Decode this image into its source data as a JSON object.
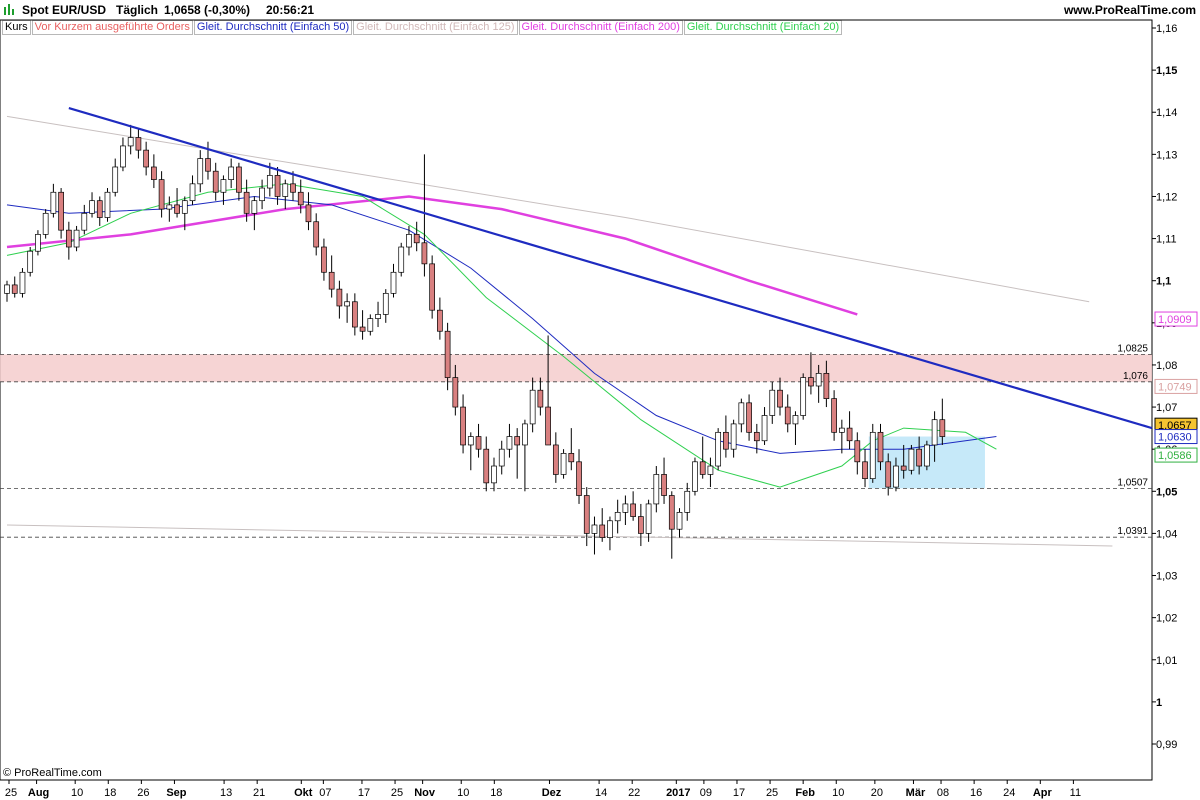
{
  "header": {
    "symbol": "Spot EUR/USD",
    "interval": "Täglich",
    "quote": "1,0658 (-0,30%)",
    "time": "20:56:21",
    "site": "www.ProRealTime.com"
  },
  "legend": [
    {
      "label": "Kurs",
      "color": "#000000"
    },
    {
      "label": "Vor Kurzem ausgeführte Orders",
      "color": "#e86060"
    },
    {
      "label": "Gleit. Durchschnitt (Einfach 50)",
      "color": "#1e2bc0"
    },
    {
      "label": "Gleit. Durchschnitt (Einfach 125)",
      "color": "#d0b8b8"
    },
    {
      "label": "Gleit. Durchschnitt (Einfach 200)",
      "color": "#e040e0"
    },
    {
      "label": "Gleit. Durchschnitt (Einfach 20)",
      "color": "#30d050"
    }
  ],
  "copyright": "© ProRealTime.com",
  "chart_data": {
    "type": "candlestick",
    "ylim": [
      0.982,
      1.165
    ],
    "y_ticks": [
      "1,16",
      "1,15",
      "1,14",
      "1,13",
      "1,12",
      "1,11",
      "1,1",
      "1,09",
      "1,08",
      "1,07",
      "1,06",
      "1,05",
      "1,04",
      "1,03",
      "1,02",
      "1,01",
      "1",
      "0,99"
    ],
    "y_tick_values": [
      1.16,
      1.15,
      1.14,
      1.13,
      1.12,
      1.11,
      1.1,
      1.09,
      1.08,
      1.07,
      1.06,
      1.05,
      1.04,
      1.03,
      1.02,
      1.01,
      1.0,
      0.99
    ],
    "y_bold_ticks": [
      "1,15",
      "1,1",
      "1,05",
      "1"
    ],
    "x_ticks": [
      {
        "label": "25",
        "d": 0
      },
      {
        "label": "Aug",
        "d": 5,
        "bold": true
      },
      {
        "label": "10",
        "d": 12
      },
      {
        "label": "18",
        "d": 18
      },
      {
        "label": "26",
        "d": 24
      },
      {
        "label": "Sep",
        "d": 30,
        "bold": true
      },
      {
        "label": "13",
        "d": 39
      },
      {
        "label": "21",
        "d": 45
      },
      {
        "label": "Okt",
        "d": 53,
        "bold": true
      },
      {
        "label": "07",
        "d": 57
      },
      {
        "label": "17",
        "d": 64
      },
      {
        "label": "25",
        "d": 70
      },
      {
        "label": "Nov",
        "d": 75,
        "bold": true
      },
      {
        "label": "10",
        "d": 82
      },
      {
        "label": "18",
        "d": 88
      },
      {
        "label": "Dez",
        "d": 98,
        "bold": true
      },
      {
        "label": "14",
        "d": 107
      },
      {
        "label": "22",
        "d": 113
      },
      {
        "label": "2017",
        "d": 121,
        "bold": true
      },
      {
        "label": "09",
        "d": 126
      },
      {
        "label": "17",
        "d": 132
      },
      {
        "label": "25",
        "d": 138
      },
      {
        "label": "Feb",
        "d": 144,
        "bold": true
      },
      {
        "label": "10",
        "d": 150
      },
      {
        "label": "20",
        "d": 157
      },
      {
        "label": "Mär",
        "d": 164,
        "bold": true
      },
      {
        "label": "08",
        "d": 169
      },
      {
        "label": "16",
        "d": 175
      },
      {
        "label": "24",
        "d": 181
      },
      {
        "label": "Apr",
        "d": 187,
        "bold": true
      },
      {
        "label": "11",
        "d": 193
      }
    ],
    "candles": [
      [
        1.097,
        1.1,
        1.095,
        1.099
      ],
      [
        1.099,
        1.101,
        1.096,
        1.097
      ],
      [
        1.097,
        1.103,
        1.096,
        1.102
      ],
      [
        1.102,
        1.108,
        1.101,
        1.107
      ],
      [
        1.107,
        1.112,
        1.106,
        1.111
      ],
      [
        1.111,
        1.117,
        1.11,
        1.116
      ],
      [
        1.116,
        1.123,
        1.115,
        1.121
      ],
      [
        1.121,
        1.122,
        1.11,
        1.112
      ],
      [
        1.112,
        1.114,
        1.105,
        1.108
      ],
      [
        1.108,
        1.113,
        1.107,
        1.112
      ],
      [
        1.112,
        1.118,
        1.111,
        1.116
      ],
      [
        1.116,
        1.121,
        1.115,
        1.119
      ],
      [
        1.119,
        1.12,
        1.113,
        1.115
      ],
      [
        1.115,
        1.122,
        1.114,
        1.121
      ],
      [
        1.121,
        1.129,
        1.12,
        1.127
      ],
      [
        1.127,
        1.134,
        1.126,
        1.132
      ],
      [
        1.132,
        1.137,
        1.13,
        1.134
      ],
      [
        1.134,
        1.136,
        1.129,
        1.131
      ],
      [
        1.131,
        1.133,
        1.125,
        1.127
      ],
      [
        1.127,
        1.13,
        1.122,
        1.124
      ],
      [
        1.124,
        1.126,
        1.115,
        1.117
      ],
      [
        1.117,
        1.12,
        1.114,
        1.118
      ],
      [
        1.118,
        1.122,
        1.115,
        1.116
      ],
      [
        1.116,
        1.12,
        1.112,
        1.119
      ],
      [
        1.119,
        1.125,
        1.118,
        1.123
      ],
      [
        1.123,
        1.131,
        1.121,
        1.129
      ],
      [
        1.129,
        1.133,
        1.124,
        1.126
      ],
      [
        1.126,
        1.128,
        1.119,
        1.121
      ],
      [
        1.121,
        1.125,
        1.118,
        1.124
      ],
      [
        1.124,
        1.129,
        1.122,
        1.127
      ],
      [
        1.127,
        1.128,
        1.119,
        1.121
      ],
      [
        1.121,
        1.124,
        1.114,
        1.116
      ],
      [
        1.116,
        1.12,
        1.112,
        1.119
      ],
      [
        1.119,
        1.124,
        1.117,
        1.122
      ],
      [
        1.122,
        1.128,
        1.12,
        1.125
      ],
      [
        1.125,
        1.127,
        1.118,
        1.12
      ],
      [
        1.12,
        1.124,
        1.117,
        1.123
      ],
      [
        1.123,
        1.126,
        1.119,
        1.121
      ],
      [
        1.121,
        1.124,
        1.116,
        1.118
      ],
      [
        1.118,
        1.121,
        1.112,
        1.114
      ],
      [
        1.114,
        1.116,
        1.106,
        1.108
      ],
      [
        1.108,
        1.11,
        1.1,
        1.102
      ],
      [
        1.102,
        1.106,
        1.096,
        1.098
      ],
      [
        1.098,
        1.1,
        1.091,
        1.094
      ],
      [
        1.094,
        1.097,
        1.09,
        1.095
      ],
      [
        1.095,
        1.097,
        1.087,
        1.089
      ],
      [
        1.089,
        1.093,
        1.086,
        1.088
      ],
      [
        1.088,
        1.092,
        1.087,
        1.091
      ],
      [
        1.091,
        1.095,
        1.089,
        1.092
      ],
      [
        1.092,
        1.098,
        1.09,
        1.097
      ],
      [
        1.097,
        1.104,
        1.096,
        1.102
      ],
      [
        1.102,
        1.109,
        1.101,
        1.108
      ],
      [
        1.108,
        1.113,
        1.106,
        1.111
      ],
      [
        1.111,
        1.114,
        1.107,
        1.109
      ],
      [
        1.109,
        1.13,
        1.101,
        1.104
      ],
      [
        1.104,
        1.106,
        1.091,
        1.093
      ],
      [
        1.093,
        1.096,
        1.086,
        1.088
      ],
      [
        1.088,
        1.09,
        1.074,
        1.077
      ],
      [
        1.077,
        1.08,
        1.068,
        1.07
      ],
      [
        1.07,
        1.073,
        1.059,
        1.061
      ],
      [
        1.061,
        1.064,
        1.055,
        1.063
      ],
      [
        1.063,
        1.066,
        1.058,
        1.06
      ],
      [
        1.06,
        1.063,
        1.05,
        1.052
      ],
      [
        1.052,
        1.058,
        1.05,
        1.056
      ],
      [
        1.056,
        1.062,
        1.054,
        1.06
      ],
      [
        1.06,
        1.066,
        1.058,
        1.063
      ],
      [
        1.063,
        1.065,
        1.053,
        1.061
      ],
      [
        1.061,
        1.067,
        1.05,
        1.066
      ],
      [
        1.066,
        1.077,
        1.064,
        1.074
      ],
      [
        1.074,
        1.077,
        1.068,
        1.07
      ],
      [
        1.07,
        1.087,
        1.066,
        1.061
      ],
      [
        1.061,
        1.064,
        1.052,
        1.054
      ],
      [
        1.054,
        1.06,
        1.053,
        1.059
      ],
      [
        1.059,
        1.065,
        1.055,
        1.057
      ],
      [
        1.057,
        1.06,
        1.047,
        1.049
      ],
      [
        1.049,
        1.051,
        1.037,
        1.04
      ],
      [
        1.04,
        1.044,
        1.035,
        1.042
      ],
      [
        1.042,
        1.046,
        1.038,
        1.039
      ],
      [
        1.039,
        1.044,
        1.036,
        1.043
      ],
      [
        1.043,
        1.048,
        1.04,
        1.045
      ],
      [
        1.045,
        1.049,
        1.042,
        1.047
      ],
      [
        1.047,
        1.05,
        1.043,
        1.044
      ],
      [
        1.044,
        1.047,
        1.037,
        1.04
      ],
      [
        1.04,
        1.048,
        1.038,
        1.047
      ],
      [
        1.047,
        1.056,
        1.045,
        1.054
      ],
      [
        1.054,
        1.058,
        1.047,
        1.049
      ],
      [
        1.049,
        1.05,
        1.034,
        1.041
      ],
      [
        1.041,
        1.046,
        1.039,
        1.045
      ],
      [
        1.045,
        1.052,
        1.043,
        1.05
      ],
      [
        1.05,
        1.058,
        1.049,
        1.057
      ],
      [
        1.057,
        1.063,
        1.053,
        1.054
      ],
      [
        1.054,
        1.058,
        1.051,
        1.056
      ],
      [
        1.056,
        1.065,
        1.055,
        1.064
      ],
      [
        1.064,
        1.068,
        1.058,
        1.06
      ],
      [
        1.06,
        1.067,
        1.058,
        1.066
      ],
      [
        1.066,
        1.072,
        1.064,
        1.071
      ],
      [
        1.071,
        1.073,
        1.062,
        1.064
      ],
      [
        1.064,
        1.066,
        1.059,
        1.062
      ],
      [
        1.062,
        1.07,
        1.061,
        1.068
      ],
      [
        1.068,
        1.076,
        1.066,
        1.074
      ],
      [
        1.074,
        1.077,
        1.068,
        1.07
      ],
      [
        1.07,
        1.073,
        1.064,
        1.066
      ],
      [
        1.066,
        1.069,
        1.061,
        1.068
      ],
      [
        1.068,
        1.078,
        1.067,
        1.077
      ],
      [
        1.077,
        1.083,
        1.073,
        1.075
      ],
      [
        1.075,
        1.08,
        1.071,
        1.078
      ],
      [
        1.078,
        1.081,
        1.07,
        1.072
      ],
      [
        1.072,
        1.074,
        1.062,
        1.064
      ],
      [
        1.064,
        1.067,
        1.059,
        1.065
      ],
      [
        1.065,
        1.069,
        1.06,
        1.062
      ],
      [
        1.062,
        1.064,
        1.054,
        1.057
      ],
      [
        1.057,
        1.06,
        1.051,
        1.053
      ],
      [
        1.053,
        1.066,
        1.052,
        1.064
      ],
      [
        1.064,
        1.066,
        1.055,
        1.057
      ],
      [
        1.057,
        1.059,
        1.049,
        1.051
      ],
      [
        1.051,
        1.058,
        1.05,
        1.056
      ],
      [
        1.056,
        1.061,
        1.053,
        1.055
      ],
      [
        1.055,
        1.061,
        1.054,
        1.06
      ],
      [
        1.06,
        1.063,
        1.054,
        1.056
      ],
      [
        1.056,
        1.062,
        1.055,
        1.061
      ],
      [
        1.061,
        1.069,
        1.057,
        1.067
      ],
      [
        1.067,
        1.072,
        1.061,
        1.063
      ]
    ],
    "sma20": [
      [
        0,
        1.106
      ],
      [
        8,
        1.109
      ],
      [
        16,
        1.116
      ],
      [
        26,
        1.121
      ],
      [
        36,
        1.123
      ],
      [
        46,
        1.12
      ],
      [
        54,
        1.111
      ],
      [
        62,
        1.096
      ],
      [
        72,
        1.082
      ],
      [
        82,
        1.067
      ],
      [
        92,
        1.055
      ],
      [
        100,
        1.051
      ],
      [
        108,
        1.056
      ],
      [
        112,
        1.062
      ],
      [
        116,
        1.065
      ],
      [
        124,
        1.064
      ],
      [
        128,
        1.06
      ]
    ],
    "sma50": [
      [
        0,
        1.118
      ],
      [
        8,
        1.116
      ],
      [
        20,
        1.117
      ],
      [
        32,
        1.12
      ],
      [
        42,
        1.118
      ],
      [
        52,
        1.112
      ],
      [
        60,
        1.103
      ],
      [
        68,
        1.091
      ],
      [
        76,
        1.078
      ],
      [
        84,
        1.068
      ],
      [
        92,
        1.062
      ],
      [
        100,
        1.059
      ],
      [
        108,
        1.06
      ],
      [
        116,
        1.06
      ],
      [
        128,
        1.063
      ]
    ],
    "sma125": [
      [
        0,
        1.139
      ],
      [
        40,
        1.127
      ],
      [
        80,
        1.115
      ],
      [
        140,
        1.095
      ]
    ],
    "sma200": [
      [
        0,
        1.108
      ],
      [
        16,
        1.111
      ],
      [
        36,
        1.117
      ],
      [
        52,
        1.12
      ],
      [
        64,
        1.117
      ],
      [
        80,
        1.11
      ],
      [
        96,
        1.1
      ],
      [
        110,
        1.092
      ]
    ],
    "trendline": [
      [
        8,
        1.141
      ],
      [
        143,
        1.065
      ]
    ],
    "lower_gray_line": [
      [
        0,
        1.042
      ],
      [
        143,
        1.037
      ]
    ],
    "resistance_zone": [
      1.076,
      1.0825
    ],
    "consolidation_box": {
      "from_candle": 112,
      "to_candle": 126,
      "low": 1.0507,
      "high": 1.063
    },
    "levels": [
      {
        "label": "1,0825",
        "value": 1.0825
      },
      {
        "label": "1,076",
        "value": 1.076
      },
      {
        "label": "1,0507",
        "value": 1.0507
      },
      {
        "label": "1,0391",
        "value": 1.0391
      }
    ],
    "price_badges": [
      {
        "label": "1,0909",
        "value": 1.0909,
        "color": "#e040e0",
        "bg": "#ffffff"
      },
      {
        "label": "1,0749",
        "value": 1.0749,
        "color": "#d9a0a0",
        "bg": "#ffffff"
      },
      {
        "label": "1,0657",
        "value": 1.0657,
        "color": "#000000",
        "bg": "#f5c431"
      },
      {
        "label": "1,0630",
        "value": 1.063,
        "color": "#1e2bc0",
        "bg": "#ffffff"
      },
      {
        "label": "1,0586",
        "value": 1.0586,
        "color": "#30b040",
        "bg": "#ffffff"
      }
    ],
    "colors": {
      "up": "#ffffff",
      "down": "#d98080",
      "sma20": "#30d050",
      "sma50": "#1e2bc0",
      "sma125": "#c8c0c0",
      "sma200": "#e040e0",
      "trend": "#1e2bc0",
      "zone": "#f4cccc",
      "box": "#b8e4f8"
    }
  }
}
